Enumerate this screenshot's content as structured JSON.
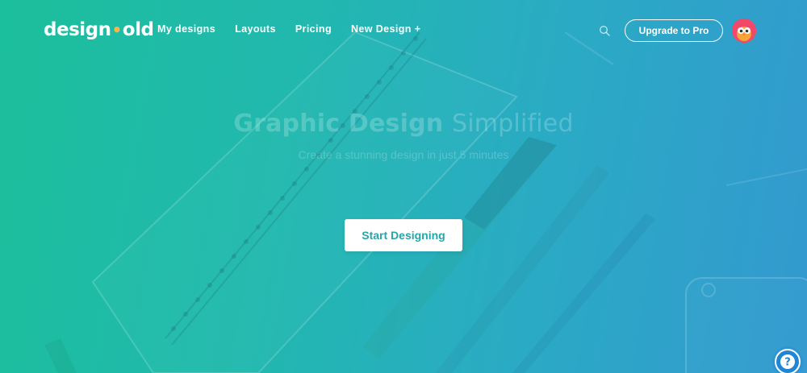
{
  "brand": {
    "logo_left": "design",
    "logo_accent": "•",
    "logo_right": "old"
  },
  "nav": {
    "items": [
      {
        "label": "My designs"
      },
      {
        "label": "Layouts"
      },
      {
        "label": "Pricing"
      },
      {
        "label": "New Design +"
      }
    ],
    "upgrade_label": "Upgrade to Pro",
    "search_icon": "search-icon",
    "avatar_icon": "owl-avatar"
  },
  "hero": {
    "title_strong": "Graphic Design",
    "title_light": "Simplified",
    "subtitle": "Create a stunning design in just 5 minutes",
    "cta_label": "Start Designing"
  },
  "help": {
    "icon": "question-icon"
  },
  "colors": {
    "gradient_start": "#1cbf9c",
    "gradient_end": "#3399cf",
    "logo_accent": "#f8b54a",
    "cta_text": "#25a6a8",
    "avatar_bg": "#f2486a",
    "help_bg": "#1f86d6"
  }
}
